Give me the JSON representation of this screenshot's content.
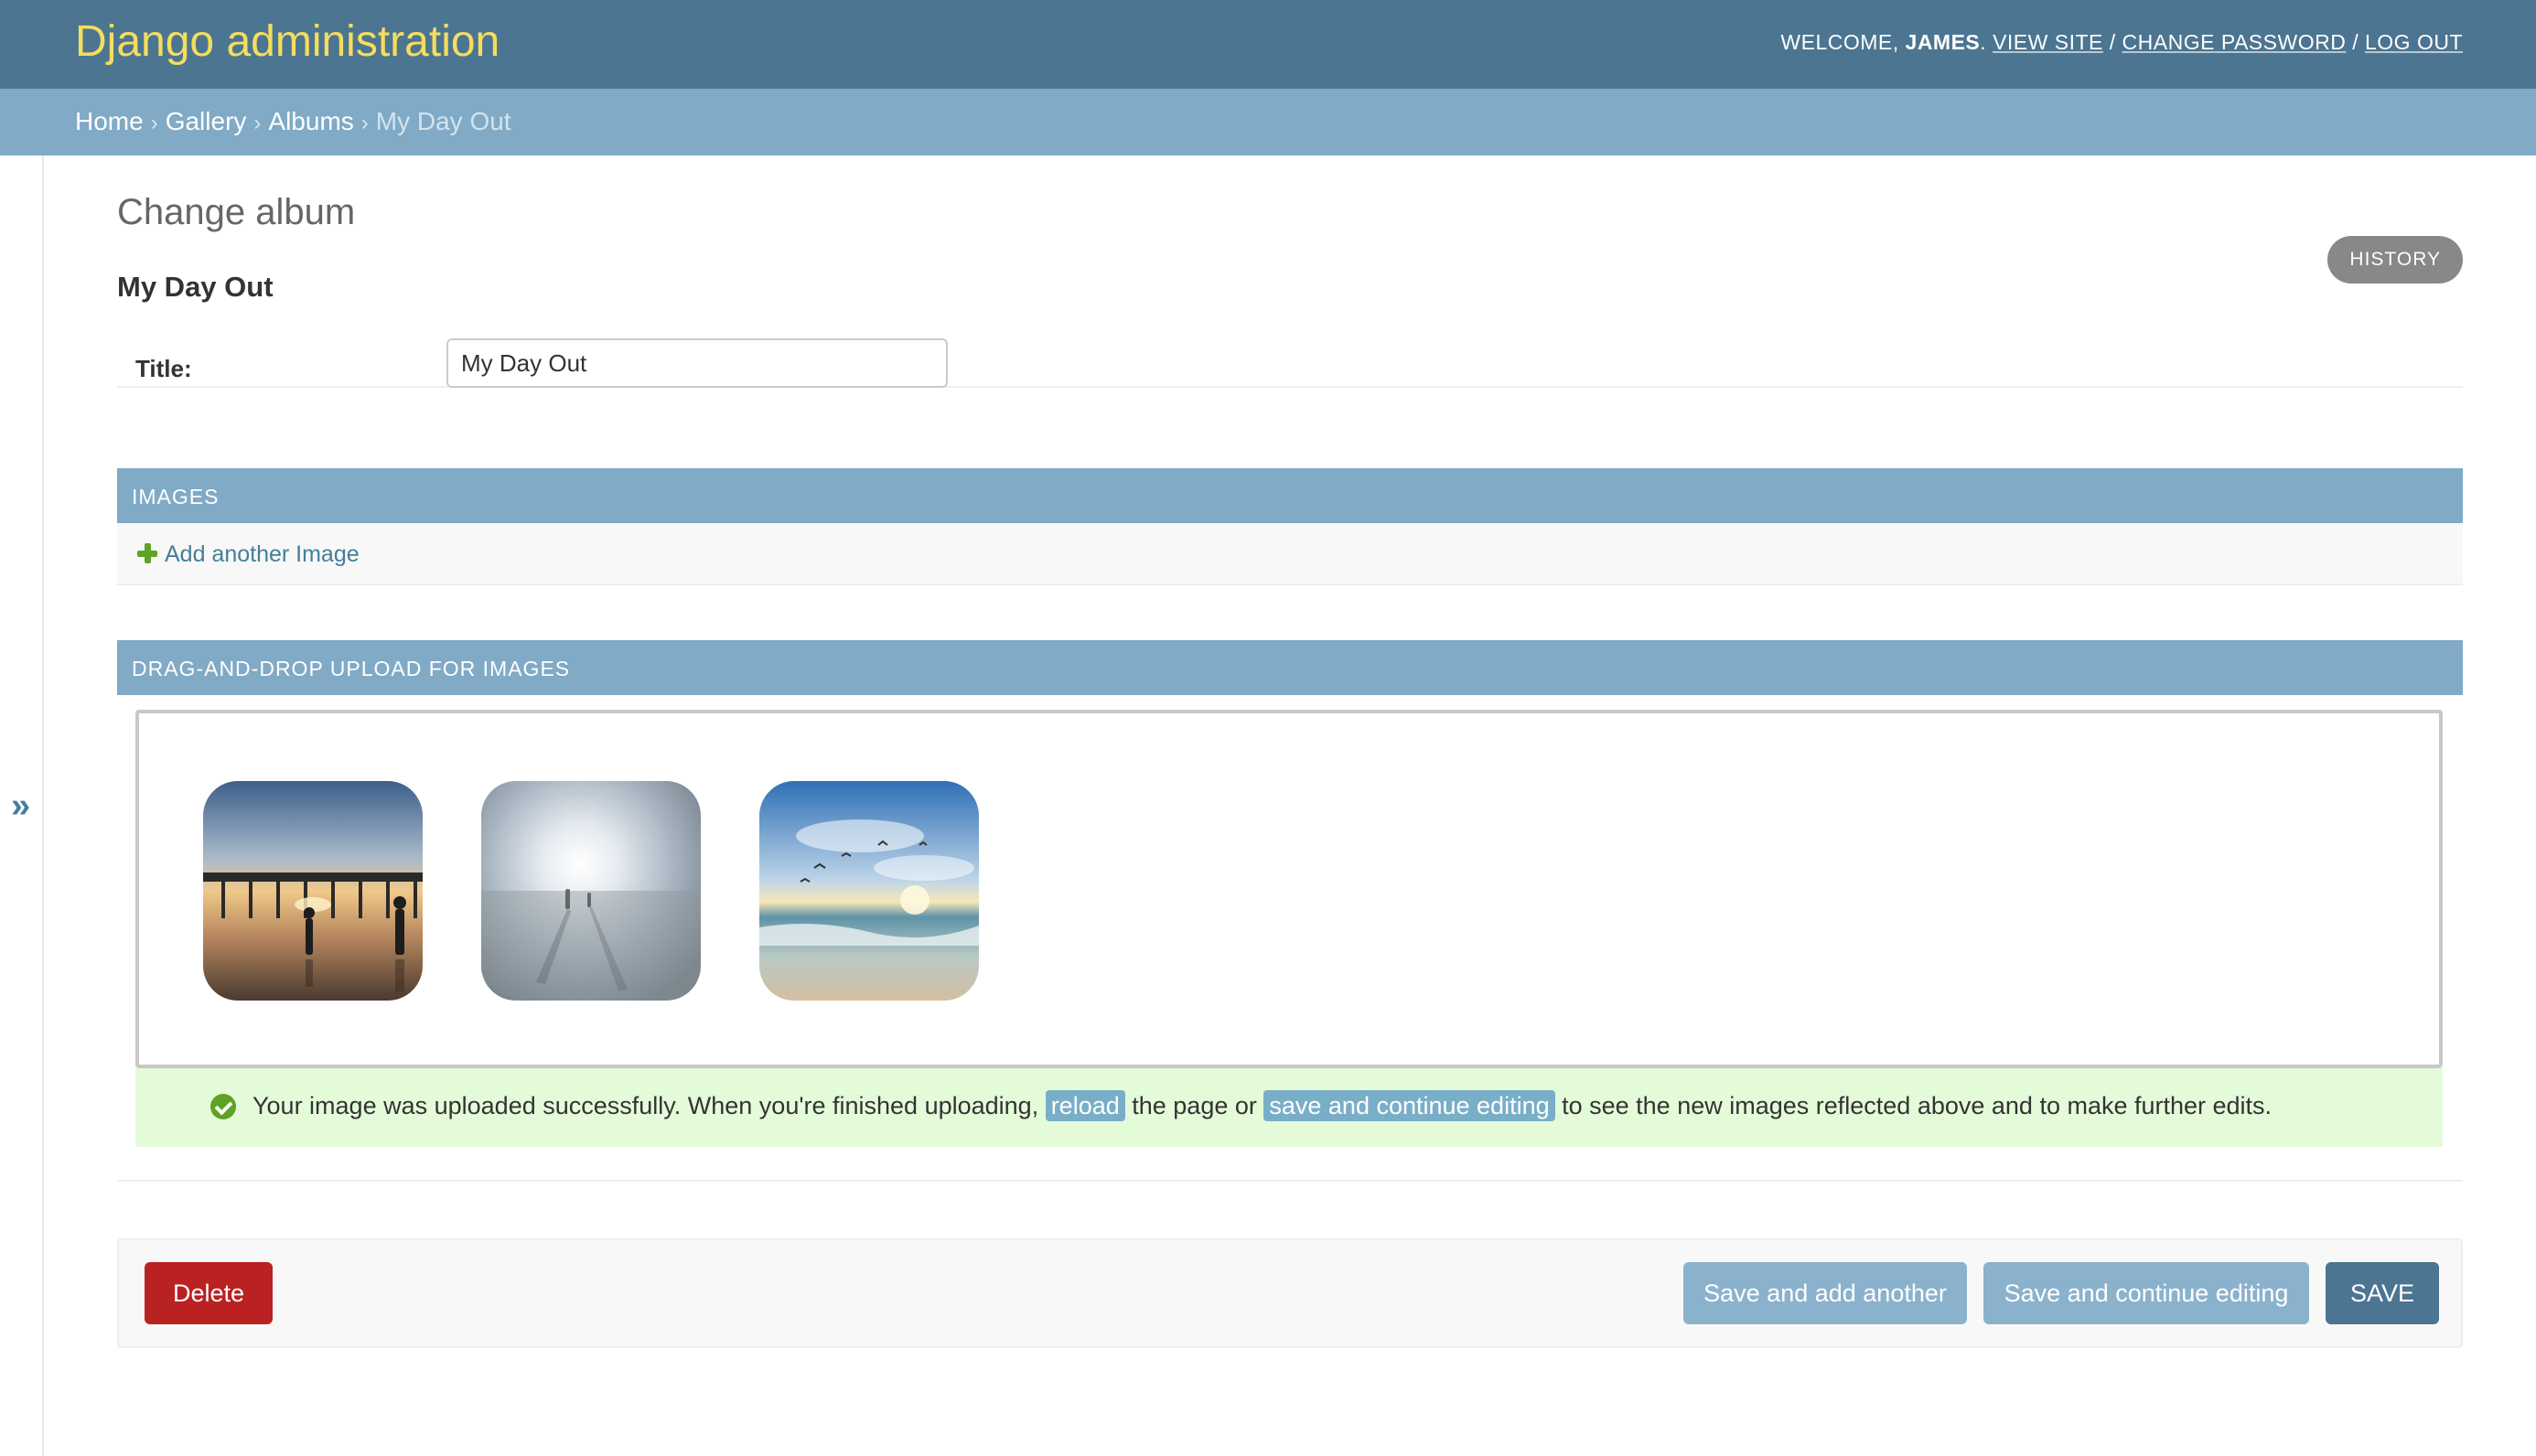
{
  "header": {
    "site_name": "Django administration",
    "welcome_prefix": "Welcome, ",
    "username": "James",
    "welcome_suffix": ". ",
    "view_site": "View site",
    "sep1": " / ",
    "change_password": "Change password",
    "sep2": " / ",
    "log_out": "Log out"
  },
  "breadcrumbs": {
    "items": [
      "Home",
      "Gallery",
      "Albums"
    ],
    "separator": "›",
    "current": "My Day Out"
  },
  "sidebar": {
    "toggle_glyph": "»"
  },
  "page": {
    "heading": "Change album",
    "history_label": "History",
    "object_title": "My Day Out"
  },
  "form": {
    "title_label": "Title:",
    "title_value": "My Day Out"
  },
  "images_inline": {
    "header": "IMAGES",
    "add_link": "Add another Image"
  },
  "dnd_upload": {
    "header": "DRAG-AND-DROP UPLOAD FOR IMAGES",
    "thumbnails": [
      "pier-beach-photo",
      "sunlit-shore-photo",
      "ocean-birds-photo"
    ],
    "message_part1": "Your image was uploaded successfully. When you're finished uploading, ",
    "reload_link": "reload",
    "message_part2": " the page or ",
    "save_continue_link": "save and continue editing",
    "message_part3": " to see the new images reflected above and to make further edits."
  },
  "submit_row": {
    "delete": "Delete",
    "save_add_another": "Save and add another",
    "save_continue": "Save and continue editing",
    "save": "SAVE"
  },
  "colors": {
    "header_bg": "#4c7591",
    "breadcrumb_bg": "#80aac6",
    "site_name": "#f5dd5d",
    "delete": "#ba2121",
    "success_bg": "#e4fbd9"
  }
}
